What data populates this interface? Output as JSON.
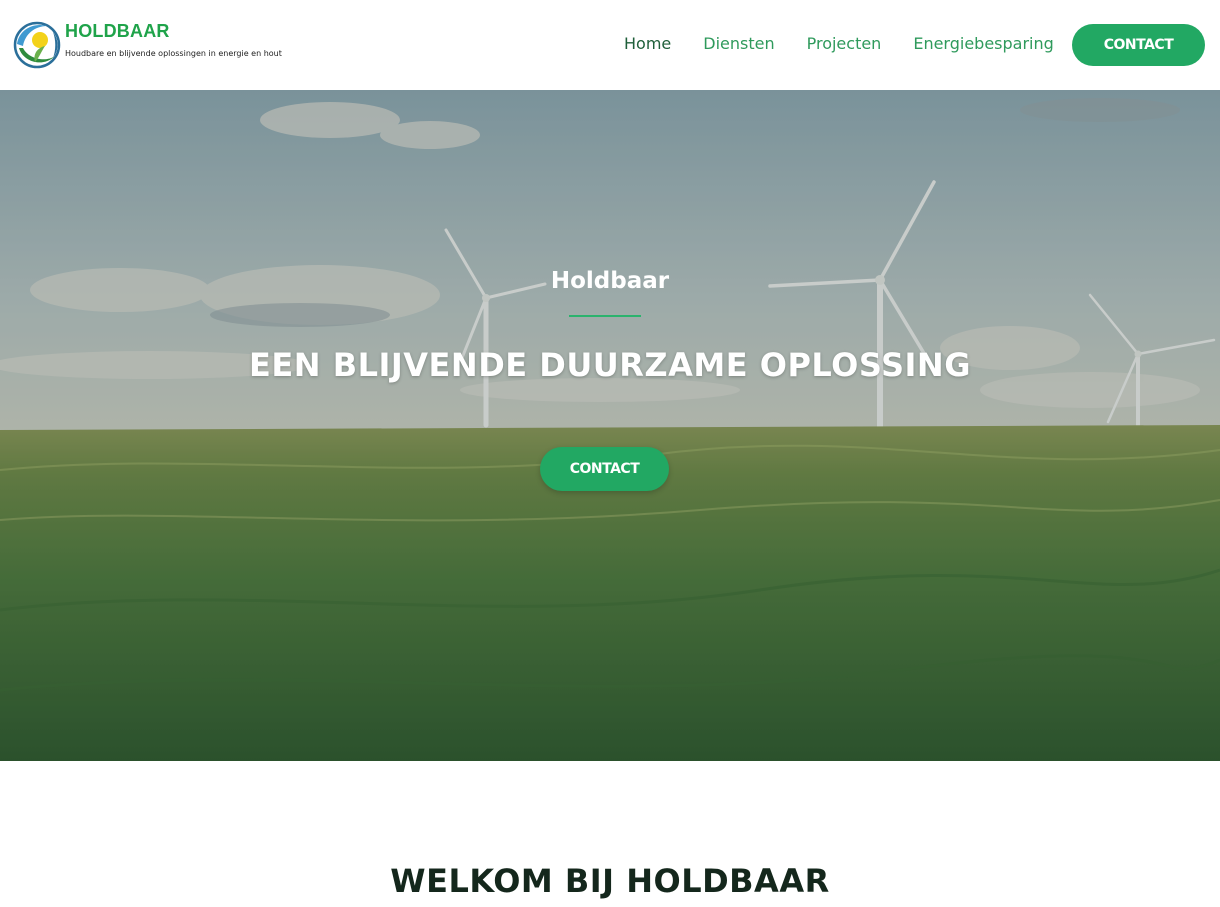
{
  "brand": {
    "name": "HOLDBAAR",
    "tagline": "Houdbare en blijvende oplossingen in energie en hout",
    "logo_icon": "sun-leaf-globe-logo"
  },
  "nav": {
    "items": [
      {
        "label": "Home",
        "active": true
      },
      {
        "label": "Diensten",
        "active": false
      },
      {
        "label": "Projecten",
        "active": false
      },
      {
        "label": "Energiebesparing",
        "active": false
      }
    ],
    "cta_label": "CONTACT"
  },
  "hero": {
    "kicker": "Holdbaar",
    "title": "EEN BLIJVENDE DUURZAME OPLOSSING",
    "cta_label": "CONTACT",
    "image": "wind-turbines-over-green-wheat-field"
  },
  "welcome": {
    "heading": "WELKOM BIJ HOLDBAAR"
  },
  "colors": {
    "accent": "#22a863",
    "nav_text": "#2f9a5c",
    "nav_active": "#1f5f3a",
    "heading_dark": "#14271c"
  }
}
